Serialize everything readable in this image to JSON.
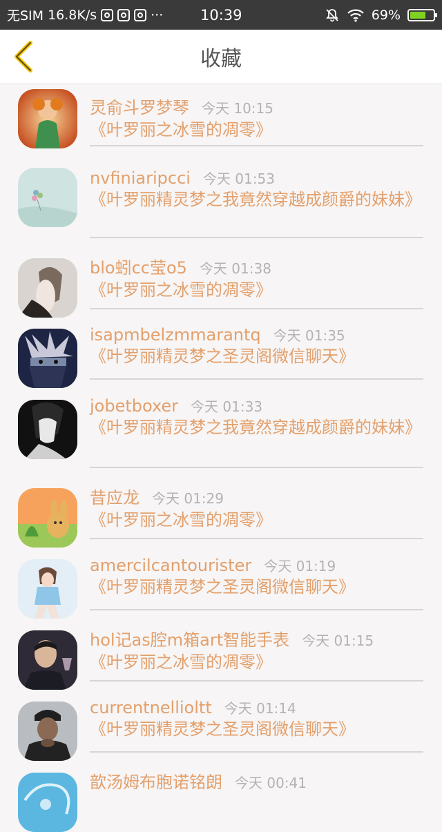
{
  "status_bar": {
    "carrier": "无SIM",
    "speed": "16.8K/s",
    "more": "···",
    "time": "10:39",
    "battery": "69%",
    "battery_level": 0.69
  },
  "nav": {
    "title": "收藏"
  },
  "colors": {
    "accent": "#e3a06c",
    "timestamp": "#b3b3b3",
    "divider": "#d6d6d6"
  },
  "items": [
    {
      "name": "灵俞斗罗梦琴",
      "time": "今天 10:15",
      "title": "《叶罗丽之冰雪的凋零》",
      "avatar": "avatar-1"
    },
    {
      "name": "nvfiniaripcci",
      "time": "今天 01:53",
      "title": "《叶罗丽精灵梦之我竟然穿越成颜爵的妹妹》",
      "avatar": "avatar-2"
    },
    {
      "name": "blo蚓cc莹o5",
      "time": "今天 01:38",
      "title": "《叶罗丽之冰雪的凋零》",
      "avatar": "avatar-3"
    },
    {
      "name": "isapmbelzmmarantq",
      "time": "今天 01:35",
      "title": "《叶罗丽精灵梦之圣灵阁微信聊天》",
      "avatar": "avatar-4"
    },
    {
      "name": "jobetboxer",
      "time": "今天 01:33",
      "title": "《叶罗丽精灵梦之我竟然穿越成颜爵的妹妹》",
      "avatar": "avatar-5"
    },
    {
      "name": "昔应龙",
      "time": "今天 01:29",
      "title": "《叶罗丽之冰雪的凋零》",
      "avatar": "avatar-6"
    },
    {
      "name": "amercilcantourister",
      "time": "今天 01:19",
      "title": "《叶罗丽精灵梦之圣灵阁微信聊天》",
      "avatar": "avatar-7"
    },
    {
      "name": "hol记as腔m箱art智能手表",
      "time": "今天 01:15",
      "title": "《叶罗丽之冰雪的凋零》",
      "avatar": "avatar-8"
    },
    {
      "name": "currentnellioltt",
      "time": "今天 01:14",
      "title": "《叶罗丽精灵梦之圣灵阁微信聊天》",
      "avatar": "avatar-9"
    },
    {
      "name": "歆汤姆布胞诺铭朗",
      "time": "今天 00:41",
      "title": "",
      "avatar": "avatar-10"
    }
  ]
}
